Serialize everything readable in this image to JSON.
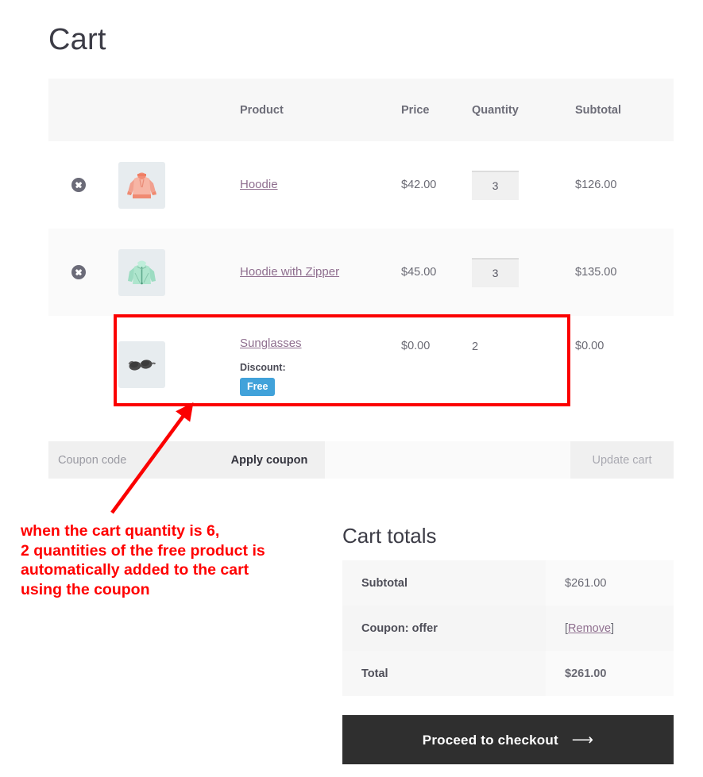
{
  "page": {
    "title": "Cart"
  },
  "cart_table": {
    "headers": [
      "",
      "",
      "Product",
      "Price",
      "Quantity",
      "Subtotal"
    ],
    "rows": [
      {
        "remove_icon": "remove-circle-x-icon",
        "thumbnail": "hoodie-thumbnail",
        "product": "Hoodie",
        "price": "$42.00",
        "quantity": "3",
        "quantity_editable": true,
        "subtotal": "$126.00",
        "removable": true
      },
      {
        "remove_icon": "remove-circle-x-icon",
        "thumbnail": "hoodie-with-zipper-thumbnail",
        "product": "Hoodie with Zipper",
        "price": "$45.00",
        "quantity": "3",
        "quantity_editable": true,
        "subtotal": "$135.00",
        "removable": true
      },
      {
        "remove_icon": "",
        "thumbnail": "sunglasses-thumbnail",
        "product": "Sunglasses",
        "price": "$0.00",
        "quantity": "2",
        "quantity_editable": false,
        "subtotal": "$0.00",
        "removable": false,
        "discount_label": "Discount:",
        "discount_badge": "Free",
        "highlighted": true
      }
    ]
  },
  "coupon": {
    "placeholder": "Coupon code",
    "value": "",
    "apply_label": "Apply coupon",
    "update_label": "Update cart"
  },
  "annotation": {
    "text": "when the cart quantity is 6,\n2 quantities of the free product is\nautomatically added to the cart\nusing the coupon"
  },
  "cart_totals": {
    "title": "Cart totals",
    "rows": [
      {
        "label": "Subtotal",
        "value": "$261.00",
        "type": "text"
      },
      {
        "label": "Coupon: offer",
        "value": "Remove",
        "type": "link"
      },
      {
        "label": "Total",
        "value": "$261.00",
        "type": "strong"
      }
    ]
  },
  "checkout": {
    "label": "Proceed to checkout",
    "arrow": "⟶"
  },
  "colors": {
    "badge_blue": "#41a2da",
    "highlight_red": "#fb0000",
    "checkout_dark": "#2f2f2f",
    "link_purple": "#8f6f8f",
    "header_bg": "#f7f7f7"
  }
}
